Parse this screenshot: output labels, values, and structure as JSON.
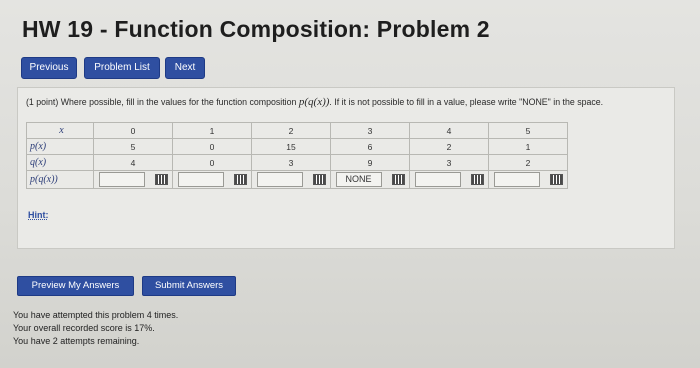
{
  "header": {
    "title": "HW 19 - Function Composition: Problem 2"
  },
  "nav": {
    "previous": "Previous",
    "problem_list": "Problem List",
    "next": "Next"
  },
  "problem": {
    "points": "(1 point)",
    "instruction_before": "Where possible, fill in the values for the function composition ",
    "composition": "p(q(x))",
    "instruction_after": ". If it is not possible to fill in a value, please write \"NONE\" in the space.",
    "row_headers": [
      "x",
      "p(x)",
      "q(x)",
      "p(q(x))"
    ],
    "x_values": [
      "0",
      "1",
      "2",
      "3",
      "4",
      "5"
    ],
    "p_values": [
      "5",
      "0",
      "15",
      "6",
      "2",
      "1"
    ],
    "q_values": [
      "4",
      "0",
      "3",
      "9",
      "3",
      "2"
    ],
    "answers": [
      "",
      "",
      "",
      "NONE",
      "",
      ""
    ],
    "hint": "Hint:"
  },
  "actions": {
    "preview": "Preview My Answers",
    "submit": "Submit Answers"
  },
  "status": {
    "attempts": "You have attempted this problem 4 times.",
    "score": "Your overall recorded score is 17%.",
    "remaining": "You have 2 attempts remaining."
  },
  "colors": {
    "button": "#2f4fa1",
    "background": "#dcdcd8"
  }
}
